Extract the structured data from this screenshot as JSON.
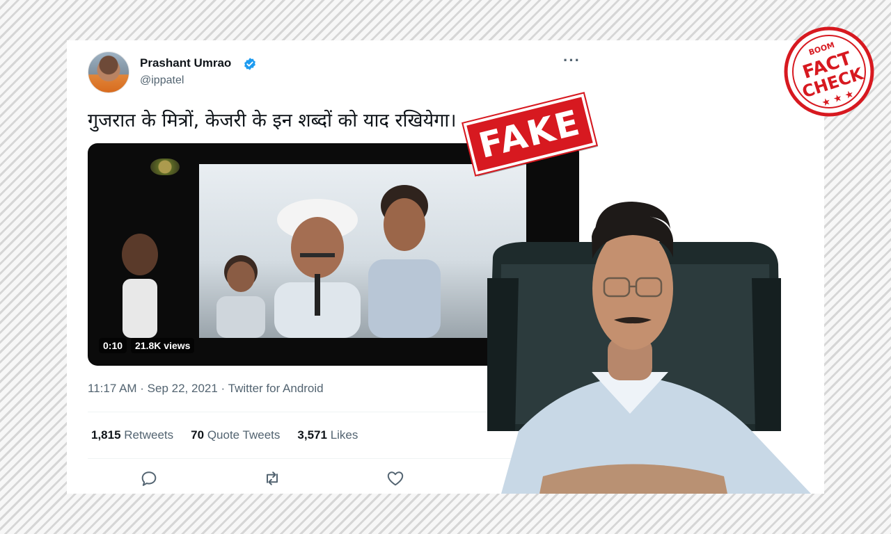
{
  "tweet": {
    "author_name": "Prashant Umrao",
    "handle": "@ippatel",
    "verified": true,
    "text": "गुजरात के मित्रों, केजरी के इन शब्दों को याद रखियेगा।",
    "video": {
      "duration": "0:10",
      "views": "21.8K views"
    },
    "timestamp": "11:17 AM · Sep 22, 2021 · Twitter for Android",
    "stats": {
      "retweets_count": "1,815",
      "retweets_label": "Retweets",
      "quotes_count": "70",
      "quotes_label": "Quote Tweets",
      "likes_count": "3,571",
      "likes_label": "Likes"
    },
    "icons": [
      "verified-badge-icon",
      "more-options-icon",
      "reply-icon",
      "retweet-icon",
      "like-icon"
    ]
  },
  "overlays": {
    "fake_stamp": "FAKE",
    "fact_check": {
      "brand": "BOOM",
      "line1": "FACT",
      "line2": "CHECK",
      "stars": "★ ★ ★"
    }
  },
  "colors": {
    "verified_blue": "#1d9bf0",
    "fake_red": "#d71920",
    "text_primary": "#0f1419",
    "text_secondary": "#536471"
  }
}
